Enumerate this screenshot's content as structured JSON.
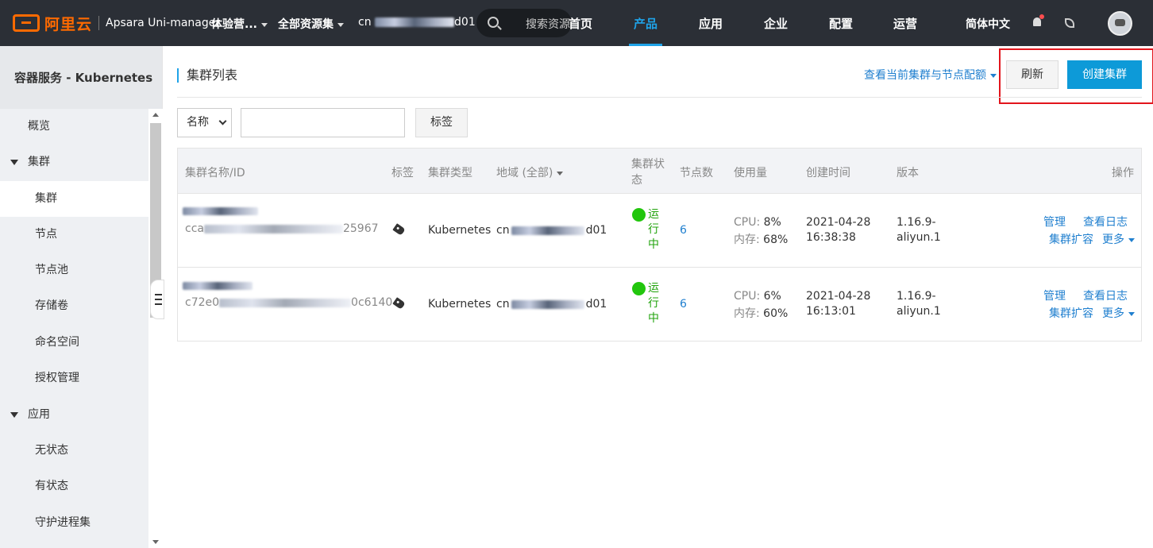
{
  "topbar": {
    "brand": "阿里云",
    "product": "Apsara Uni-manager",
    "org_dropdown": "体验营...",
    "resource_set": "全部资源集",
    "region_prefix": "cn",
    "region_suffix": "d01",
    "search_placeholder": "搜索资源",
    "nav": [
      "首页",
      "产品",
      "应用",
      "企业",
      "配置",
      "运营"
    ],
    "active_nav": "产品",
    "language": "简体中文"
  },
  "sidebar": {
    "title": "容器服务 - Kubernetes",
    "items": [
      {
        "label": "概览",
        "level": "top"
      },
      {
        "label": "集群",
        "level": "group"
      },
      {
        "label": "集群",
        "level": "sub",
        "selected": true
      },
      {
        "label": "节点",
        "level": "sub"
      },
      {
        "label": "节点池",
        "level": "sub"
      },
      {
        "label": "存储卷",
        "level": "sub"
      },
      {
        "label": "命名空间",
        "level": "sub"
      },
      {
        "label": "授权管理",
        "level": "sub"
      },
      {
        "label": "应用",
        "level": "group"
      },
      {
        "label": "无状态",
        "level": "sub"
      },
      {
        "label": "有状态",
        "level": "sub"
      },
      {
        "label": "守护进程集",
        "level": "sub"
      }
    ]
  },
  "main": {
    "title": "集群列表",
    "quota_link": "查看当前集群与节点配额",
    "refresh_label": "刷新",
    "create_label": "创建集群",
    "filter": {
      "select_value": "名称",
      "input_value": "",
      "tag_button": "标签"
    },
    "columns": [
      "集群名称/ID",
      "标签",
      "集群类型",
      "地域 (全部)",
      "集群状态",
      "节点数",
      "使用量",
      "创建时间",
      "版本",
      "操作"
    ],
    "rows": [
      {
        "id_prefix": "cca",
        "id_suffix": "25967",
        "type": "Kubernetes",
        "region_prefix": "cn",
        "region_suffix": "d01",
        "status": "运行中",
        "nodes": "6",
        "cpu_label": "CPU:",
        "cpu": "8%",
        "mem_label": "内存:",
        "mem": "68%",
        "created_date": "2021-04-28",
        "created_time": "16:38:38",
        "version_1": "1.16.9-",
        "version_2": "aliyun.1",
        "action_manage": "管理",
        "action_logs": "查看日志",
        "action_scale": "集群扩容",
        "action_more": "更多"
      },
      {
        "id_prefix": "c72e0",
        "id_suffix": "0c6140",
        "type": "Kubernetes",
        "region_prefix": "cn",
        "region_suffix": "d01",
        "status": "运行中",
        "nodes": "6",
        "cpu_label": "CPU:",
        "cpu": "6%",
        "mem_label": "内存:",
        "mem": "60%",
        "created_date": "2021-04-28",
        "created_time": "16:13:01",
        "version_1": "1.16.9-",
        "version_2": "aliyun.1",
        "action_manage": "管理",
        "action_logs": "查看日志",
        "action_scale": "集群扩容",
        "action_more": "更多"
      }
    ]
  },
  "colors": {
    "topbar": "#2b2f36",
    "accent": "#1fa3e8",
    "primary_button": "#0d9ad8",
    "link": "#1f7fcf",
    "status_running": "#22c60d",
    "highlight": "#e2151c"
  }
}
